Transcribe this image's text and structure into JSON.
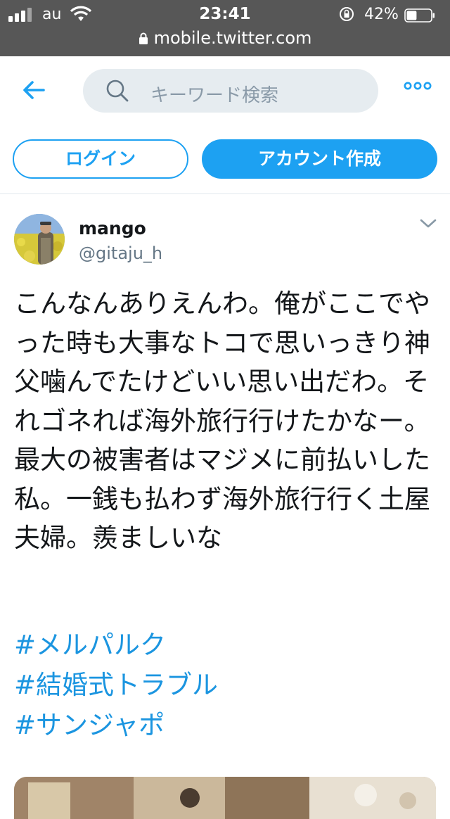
{
  "status_bar": {
    "carrier": "au",
    "time": "23:41",
    "battery_percent": "42%",
    "battery_level": 0.42,
    "url": "mobile.twitter.com"
  },
  "header": {
    "search_placeholder": "キーワード検索",
    "login_label": "ログイン",
    "signup_label": "アカウント作成"
  },
  "tweet": {
    "display_name": "mango",
    "handle": "@gitaju_h",
    "text": "こんなんありえんわ。俺がここでやった時も大事なトコで思いっきり神父噛んでたけどいい思い出だわ。それゴネれば海外旅行行けたかなー。最大の被害者はマジメに前払いした私。一銭も払わず海外旅行行く土屋夫婦。羨ましいな",
    "hashtags": [
      "#メルパルク",
      "#結婚式トラブル",
      "#サンジャポ"
    ]
  },
  "colors": {
    "accent": "#1da1f2",
    "hashtag": "#1b95e0",
    "status_bar_bg": "#575757",
    "search_bg": "#e6ecf0",
    "secondary_text": "#657786"
  }
}
